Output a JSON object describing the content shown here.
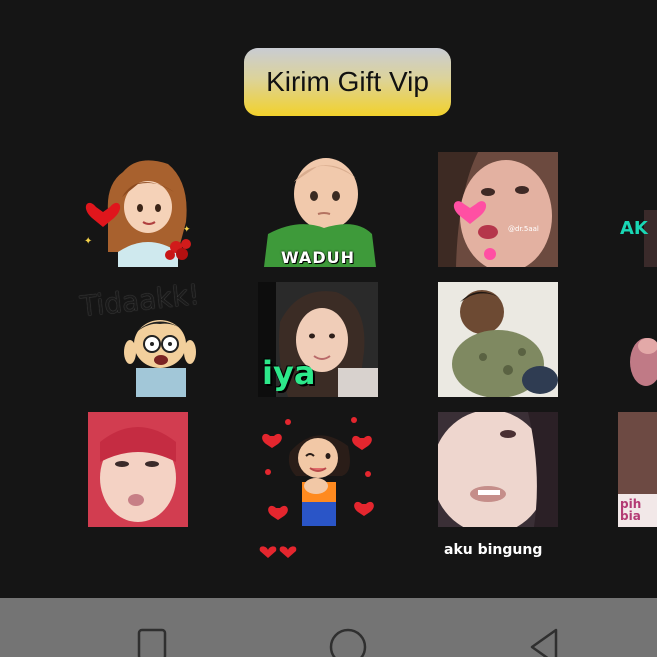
{
  "header": {
    "gift_button_label": "Kirim Gift Vip"
  },
  "stickers": {
    "waduh": "WADUH",
    "tidaakk": "Tidaakk!",
    "iya": "iya",
    "watermark": "@dr.5aal",
    "aku_bingung": "aku bingung",
    "partial_right_top": "AK",
    "partial_right_bottom": "pih bia"
  },
  "navbar": {
    "recent_icon": "square-icon",
    "home_icon": "circle-icon",
    "back_icon": "triangle-back-icon"
  },
  "colors": {
    "background": "#151515",
    "button_gradient_top": "#c9ccd3",
    "button_gradient_bottom": "#f2d12b",
    "navbar": "#747474"
  }
}
